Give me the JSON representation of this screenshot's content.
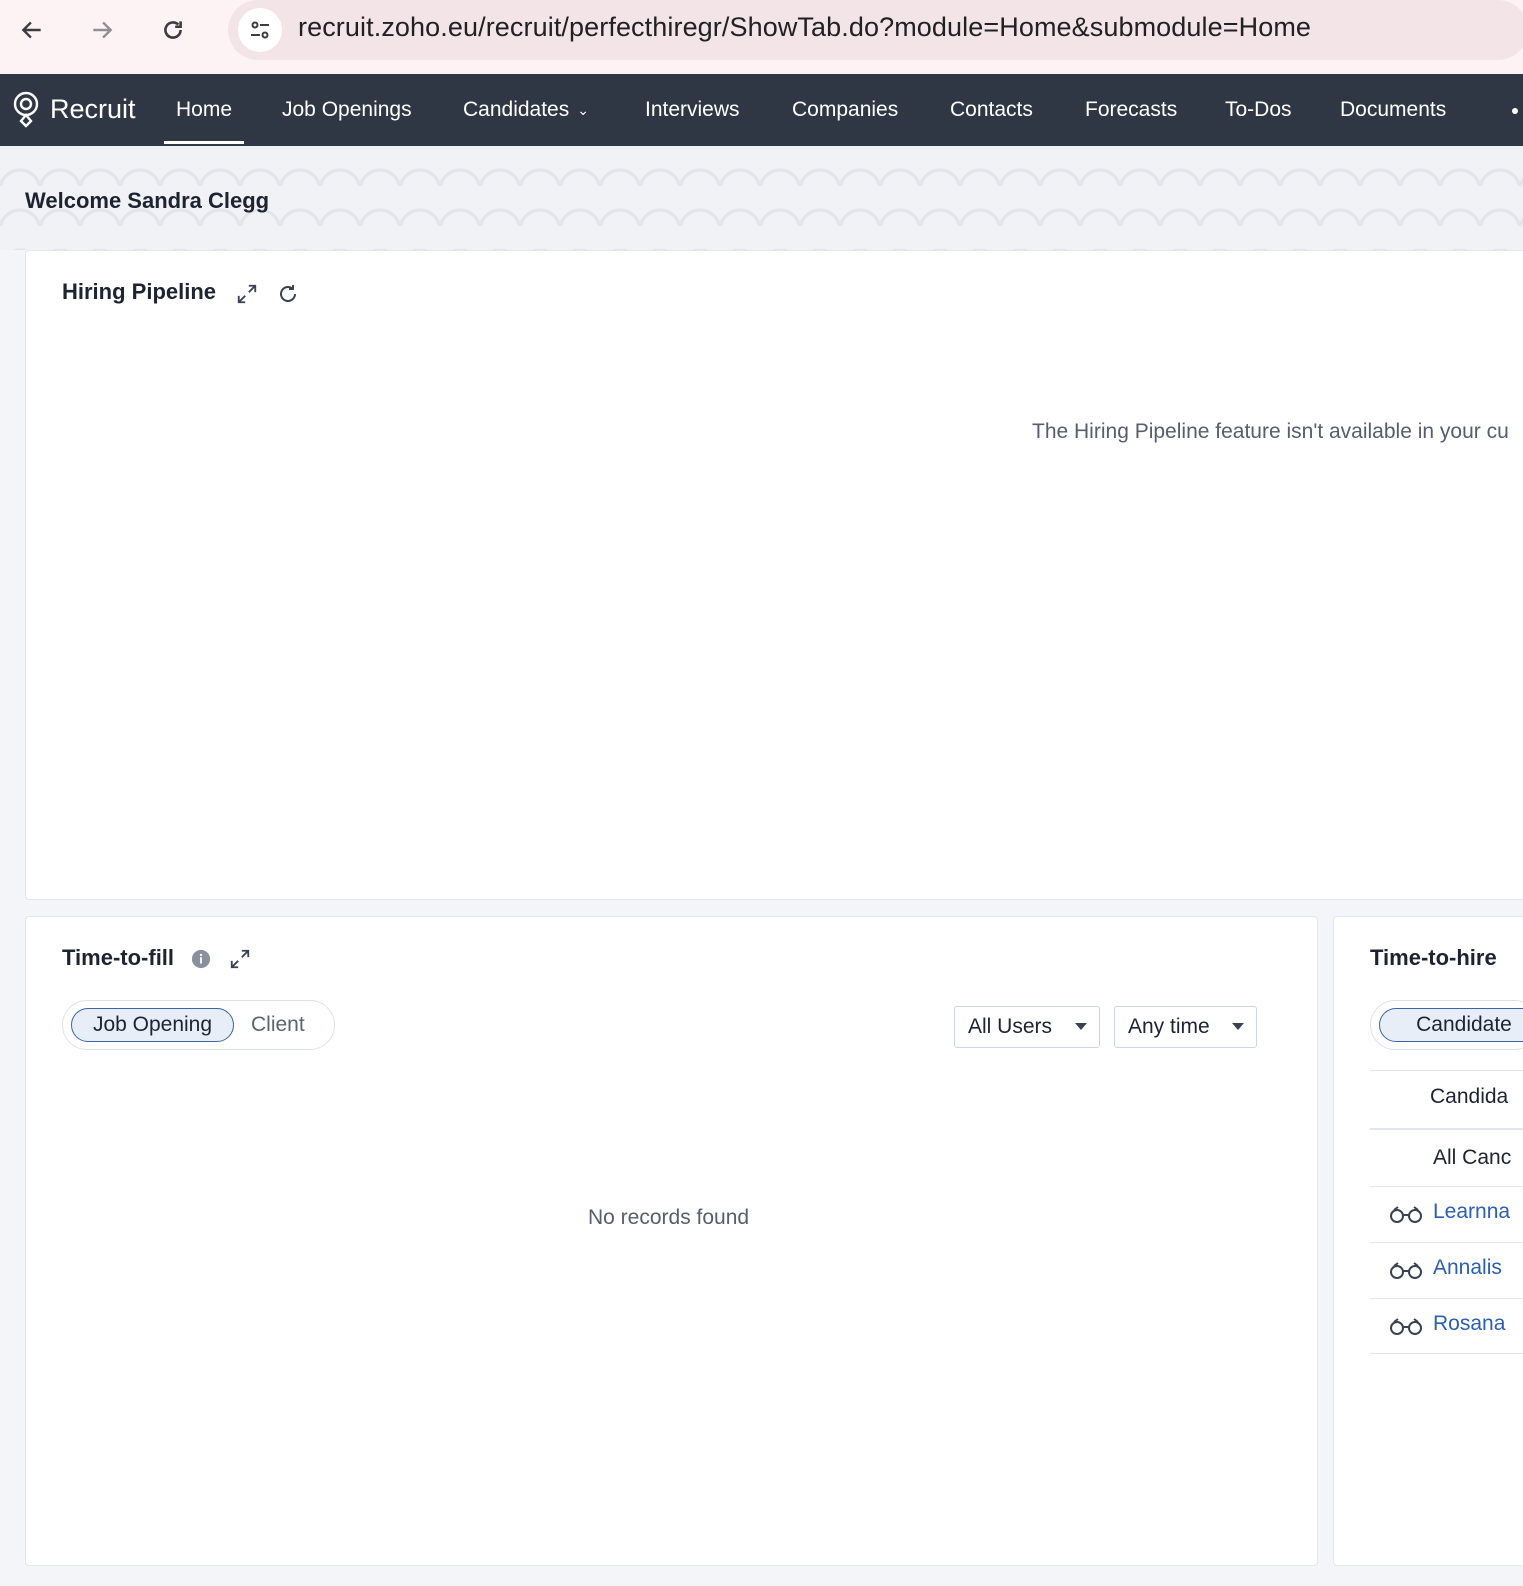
{
  "browser": {
    "url": "recruit.zoho.eu/recruit/perfecthiregr/ShowTab.do?module=Home&submodule=Home"
  },
  "app": {
    "brand": "Recruit",
    "nav": [
      {
        "label": "Home",
        "active": true
      },
      {
        "label": "Job Openings"
      },
      {
        "label": "Candidates"
      },
      {
        "label": "Interviews"
      },
      {
        "label": "Companies"
      },
      {
        "label": "Contacts"
      },
      {
        "label": "Forecasts"
      },
      {
        "label": "To-Dos"
      },
      {
        "label": "Documents"
      }
    ]
  },
  "welcome": "Welcome Sandra Clegg",
  "hiring_pipeline": {
    "title": "Hiring Pipeline",
    "message": "The Hiring Pipeline feature isn't available in your cu"
  },
  "time_to_fill": {
    "title": "Time-to-fill",
    "toggle_active": "Job Opening",
    "toggle_inactive": "Client",
    "filter_users": "All Users",
    "filter_time": "Any time",
    "empty": "No records found"
  },
  "time_to_hire": {
    "title": "Time-to-hire",
    "toggle_active": "Candidate",
    "header_1": "Candida",
    "header_2": "All Canc",
    "rows": [
      "Learnna",
      "Annalis",
      "Rosana"
    ]
  },
  "colors": {
    "nav_bg": "#2f3744",
    "link": "#2a5fb4",
    "toggle_accent": "#3a63a8"
  }
}
